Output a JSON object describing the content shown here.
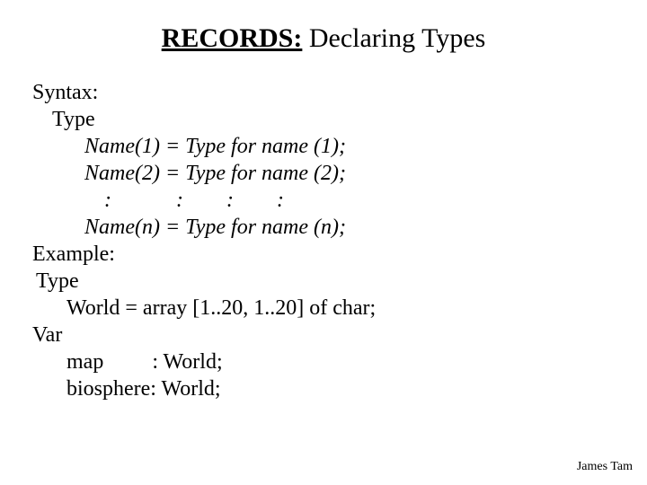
{
  "title": {
    "bold": "RECORDS:",
    "rest": " Declaring Types"
  },
  "syntax_label": "Syntax:",
  "type_keyword": "Type",
  "syntax_lines": {
    "l1": "Name(1) = Type for name (1);",
    "l2": "Name(2) = Type for name (2);",
    "dots": ":   :  :  :",
    "ln": "Name(n) = Type for name (n);"
  },
  "example_label": "Example:",
  "example": {
    "type_kw": "Type",
    "world_decl": "World = array [1..20, 1..20] of char;",
    "var_kw": "Var",
    "map_decl": "map   : World;",
    "bio_decl": "biosphere:  World;"
  },
  "footer": "James Tam"
}
